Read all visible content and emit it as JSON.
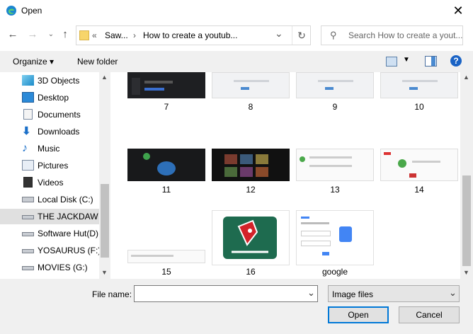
{
  "window": {
    "title": "Open"
  },
  "address": {
    "overflow": "«",
    "crumbs": [
      "Saw...",
      "How to create a youtub..."
    ]
  },
  "search": {
    "placeholder": "Search How to create a yout..."
  },
  "toolbar": {
    "organize": "Organize ▾",
    "new_folder": "New folder"
  },
  "sidebar": {
    "items": [
      {
        "label": "3D Objects"
      },
      {
        "label": "Desktop"
      },
      {
        "label": "Documents"
      },
      {
        "label": "Downloads"
      },
      {
        "label": "Music"
      },
      {
        "label": "Pictures"
      },
      {
        "label": "Videos"
      },
      {
        "label": "Local Disk (C:)"
      },
      {
        "label": "THE JACKDAW (I"
      },
      {
        "label": "Software Hut(D)"
      },
      {
        "label": "YOSAURUS (F:)"
      },
      {
        "label": "MOVIES (G:)"
      }
    ]
  },
  "files": [
    {
      "name": "7"
    },
    {
      "name": "8"
    },
    {
      "name": "9"
    },
    {
      "name": "10"
    },
    {
      "name": "11"
    },
    {
      "name": "12"
    },
    {
      "name": "13"
    },
    {
      "name": "14"
    },
    {
      "name": "15"
    },
    {
      "name": "16"
    },
    {
      "name": "google"
    }
  ],
  "bottom": {
    "file_name_label": "File name:",
    "file_name_value": "",
    "file_type": "Image files",
    "open": "Open",
    "cancel": "Cancel"
  },
  "colors": {
    "accent": "#0078d7",
    "selected": "#e0e0e0",
    "logo_green": "#1e6b4f",
    "logo_red": "#d2232a"
  }
}
